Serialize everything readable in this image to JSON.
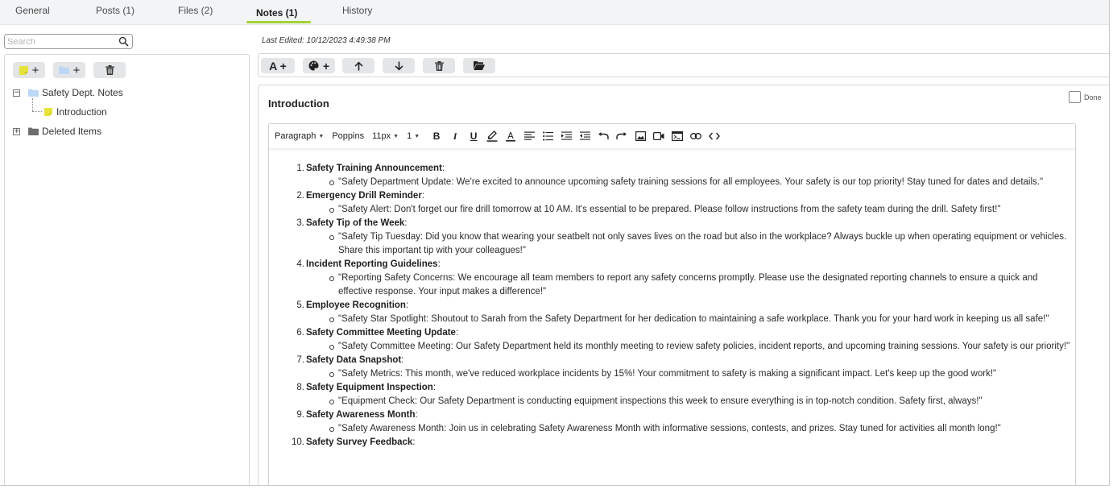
{
  "tabs": [
    {
      "label": "General",
      "active": false
    },
    {
      "label": "Posts (1)",
      "active": false
    },
    {
      "label": "Files (2)",
      "active": false
    },
    {
      "label": "Notes (1)",
      "active": true
    },
    {
      "label": "History",
      "active": false
    }
  ],
  "accent_color": "#a3d43a",
  "search": {
    "placeholder": "Search",
    "value": "",
    "icon": "search-icon"
  },
  "tree_toolbar": [
    {
      "icon": "add-note-icon",
      "label": "+"
    },
    {
      "icon": "add-folder-icon",
      "label": "+"
    },
    {
      "icon": "trash-icon"
    }
  ],
  "tree": {
    "folders": [
      {
        "label": "Safety Dept. Notes",
        "expanded": true,
        "expander": "⊟",
        "color": "#bcd8f5",
        "children": [
          {
            "label": "Introduction",
            "color": "#e6e23a"
          }
        ]
      },
      {
        "label": "Deleted Items",
        "expanded": false,
        "expander": "⊞",
        "color": "#6e6e6e"
      }
    ]
  },
  "note": {
    "last_edited": "Last Edited: 10/12/2023 4:49:38 PM",
    "title": "Introduction",
    "done_label": "Done",
    "done_checked": false
  },
  "note_toolbar": [
    {
      "icon": "font-style-icon",
      "label": "A +"
    },
    {
      "icon": "palette-icon",
      "label": "+"
    },
    {
      "icon": "arrow-up-icon"
    },
    {
      "icon": "arrow-down-icon"
    },
    {
      "icon": "trash-icon"
    },
    {
      "icon": "folder-open-icon"
    }
  ],
  "editor_toolbar": {
    "block_format": "Paragraph",
    "font": "Poppins",
    "font_size": "11px",
    "line_height": "1",
    "bold": "B",
    "italic": "I",
    "underline": "U",
    "font_color": "A",
    "icons": [
      "highlight-icon",
      "font-color-icon",
      "align-icon",
      "bullet-list-icon",
      "indent-icon",
      "outdent-icon",
      "undo-icon",
      "redo-icon",
      "image-icon",
      "video-icon",
      "embed-icon",
      "link-icon",
      "code-icon"
    ]
  },
  "content": [
    {
      "num": "1.",
      "title": "Safety Training Announcement",
      "sep": ":",
      "text": "\"Safety Department Update: We're excited to announce upcoming safety training sessions for all employees. Your safety is our top priority! Stay tuned for dates and details.\""
    },
    {
      "num": "2.",
      "title": "Emergency Drill Reminder",
      "sep": ":",
      "text": "\"Safety Alert: Don't forget our fire drill tomorrow at 10 AM. It's essential to be prepared. Please follow instructions from the safety team during the drill. Safety first!\""
    },
    {
      "num": "3.",
      "title": "Safety Tip of the Week",
      "sep": ":",
      "text": "\"Safety Tip Tuesday: Did you know that wearing your seatbelt not only saves lives on the road but also in the workplace? Always buckle up when operating equipment or vehicles. Share this important tip with your colleagues!\""
    },
    {
      "num": "4.",
      "title": "Incident Reporting Guidelines",
      "sep": ":",
      "text": "\"Reporting Safety Concerns: We encourage all team members to report any safety concerns promptly. Please use the designated reporting channels to ensure a quick and effective response. Your input makes a difference!\""
    },
    {
      "num": "5.",
      "title": "Employee Recognition",
      "sep": ":",
      "text": "\"Safety Star Spotlight: Shoutout to Sarah from the Safety Department for her dedication to maintaining a safe workplace. Thank you for your hard work in keeping us all safe!\""
    },
    {
      "num": "6.",
      "title": "Safety Committee Meeting Update",
      "sep": ":",
      "text": "\"Safety Committee Meeting: Our Safety Department held its monthly meeting to review safety policies, incident reports, and upcoming training sessions. Your safety is our priority!\""
    },
    {
      "num": "7.",
      "title": "Safety Data Snapshot",
      "sep": ":",
      "text": "\"Safety Metrics: This month, we've reduced workplace incidents by 15%! Your commitment to safety is making a significant impact. Let's keep up the good work!\""
    },
    {
      "num": "8.",
      "title": "Safety Equipment Inspection",
      "sep": ":",
      "text": "\"Equipment Check: Our Safety Department is conducting equipment inspections this week to ensure everything is in top-notch condition. Safety first, always!\""
    },
    {
      "num": "9.",
      "title": "Safety Awareness Month",
      "sep": ":",
      "text": "\"Safety Awareness Month: Join us in celebrating Safety Awareness Month with informative sessions, contests, and prizes. Stay tuned for activities all month long!\""
    },
    {
      "num": "10.",
      "title": "Safety Survey Feedback",
      "sep": ":",
      "text": ""
    }
  ]
}
